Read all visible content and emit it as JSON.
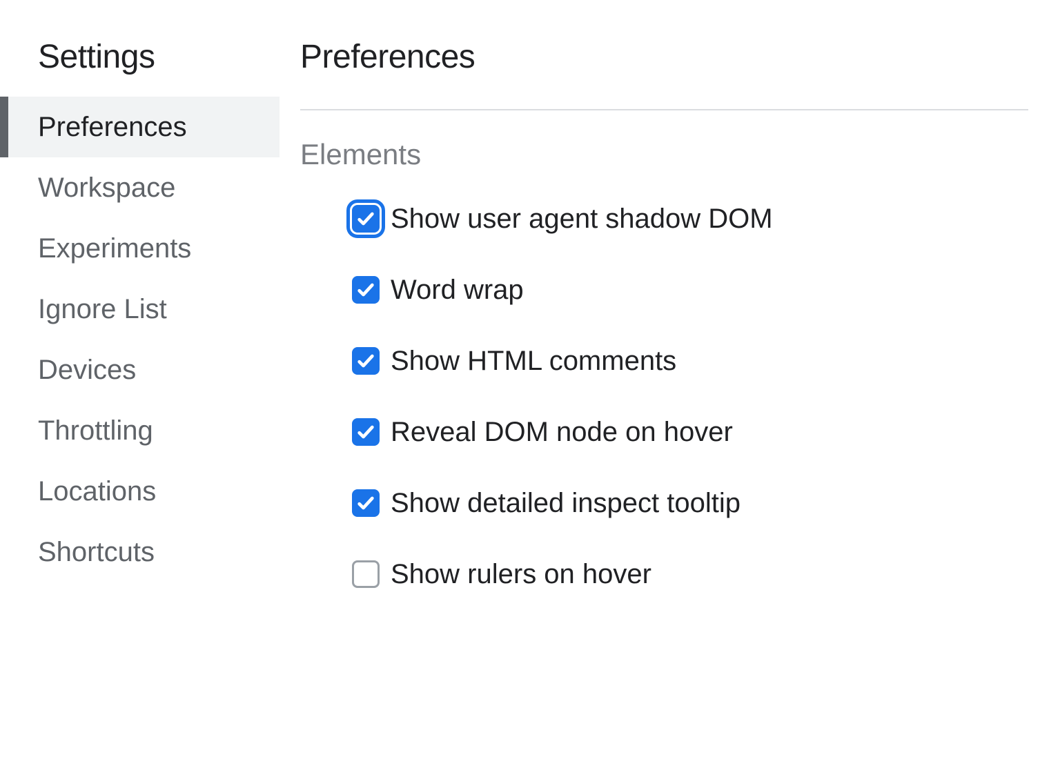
{
  "sidebar": {
    "title": "Settings",
    "items": [
      {
        "label": "Preferences",
        "active": true
      },
      {
        "label": "Workspace",
        "active": false
      },
      {
        "label": "Experiments",
        "active": false
      },
      {
        "label": "Ignore List",
        "active": false
      },
      {
        "label": "Devices",
        "active": false
      },
      {
        "label": "Throttling",
        "active": false
      },
      {
        "label": "Locations",
        "active": false
      },
      {
        "label": "Shortcuts",
        "active": false
      }
    ]
  },
  "main": {
    "title": "Preferences",
    "section": {
      "title": "Elements",
      "options": [
        {
          "label": "Show user agent shadow DOM",
          "checked": true,
          "focused": true
        },
        {
          "label": "Word wrap",
          "checked": true,
          "focused": false
        },
        {
          "label": "Show HTML comments",
          "checked": true,
          "focused": false
        },
        {
          "label": "Reveal DOM node on hover",
          "checked": true,
          "focused": false
        },
        {
          "label": "Show detailed inspect tooltip",
          "checked": true,
          "focused": false
        },
        {
          "label": "Show rulers on hover",
          "checked": false,
          "focused": false
        }
      ]
    }
  },
  "colors": {
    "accent": "#1a73e8",
    "text": "#202124",
    "muted": "#5f6368",
    "activeBg": "#f1f3f4"
  }
}
